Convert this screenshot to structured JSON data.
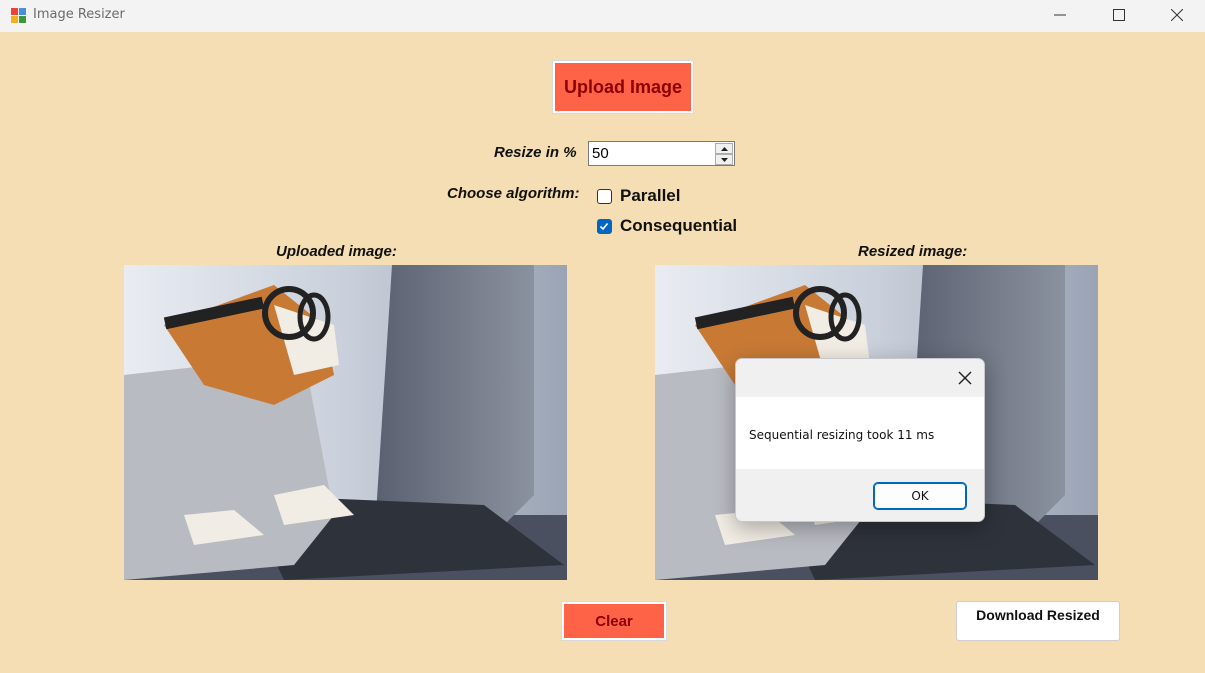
{
  "window": {
    "title": "Image Resizer",
    "icons": [
      "app-icon",
      "minimize-icon",
      "maximize-icon",
      "close-icon"
    ]
  },
  "main": {
    "upload_label": "Upload Image",
    "resize_label": "Resize in %",
    "resize_value": "50",
    "algorithm_label": "Choose algorithm:",
    "algorithms": [
      {
        "label": "Parallel",
        "checked": false
      },
      {
        "label": "Consequential",
        "checked": true
      }
    ],
    "uploaded_label": "Uploaded image:",
    "resized_label": "Resized image:",
    "clear_label": "Clear",
    "download_label": "Download Resized"
  },
  "dialog": {
    "message": "Sequential resizing took 11 ms",
    "ok_label": "OK"
  },
  "colors": {
    "background": "#F5DEB3",
    "button_accent": "#FF6347",
    "button_text": "#8B0000",
    "checkbox_checked": "#0067C0"
  }
}
